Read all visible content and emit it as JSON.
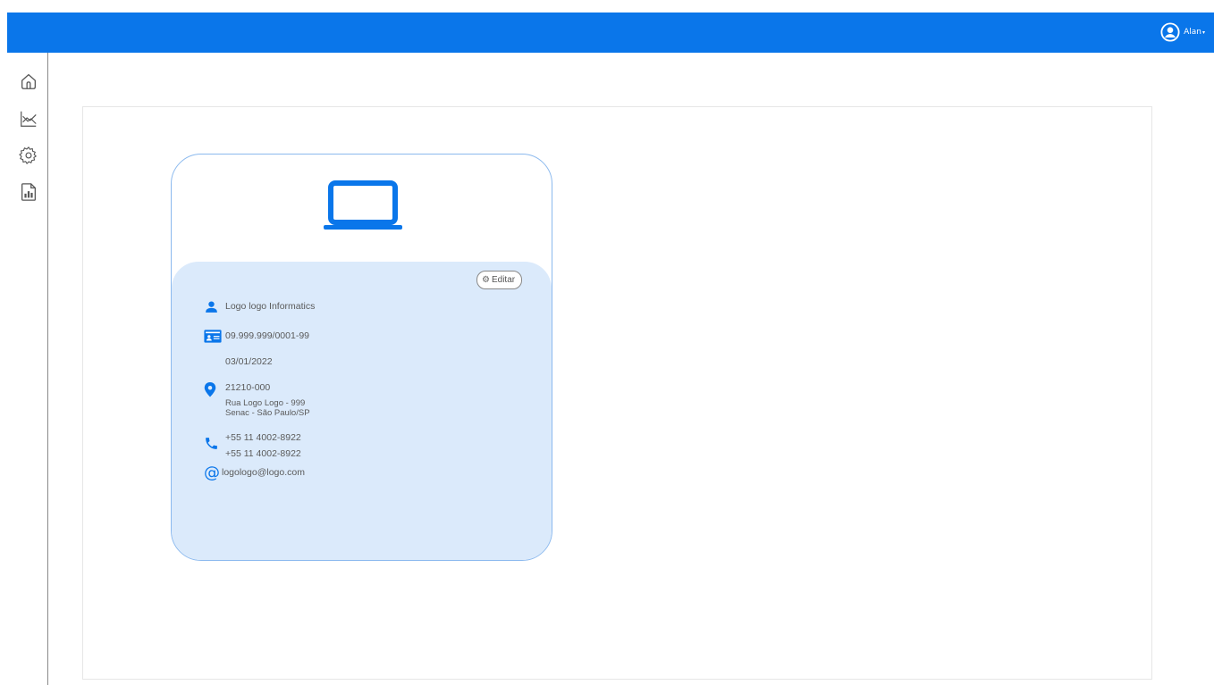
{
  "header": {
    "user_name": "Alan",
    "caret": "▾"
  },
  "sidebar": {
    "items": [
      {
        "icon": "home-icon"
      },
      {
        "icon": "line-chart-icon"
      },
      {
        "icon": "gear-icon"
      },
      {
        "icon": "report-icon"
      }
    ]
  },
  "card": {
    "edit_label": "Editar",
    "company_name": "Logo logo Informatics",
    "cnpj": "09.999.999/0001-99",
    "date": "03/01/2022",
    "cep": "21210-000",
    "address_line1": "Rua Logo Logo - 999",
    "address_line2": "Senac - São Paulo/SP",
    "phone1": "+55 11 4002-8922",
    "phone2": "+55 11 4002-8922",
    "email": "logologo@logo.com"
  },
  "colors": {
    "primary": "#0a76ea",
    "card_body": "#dbeafb",
    "card_border": "#8bb9ee"
  }
}
